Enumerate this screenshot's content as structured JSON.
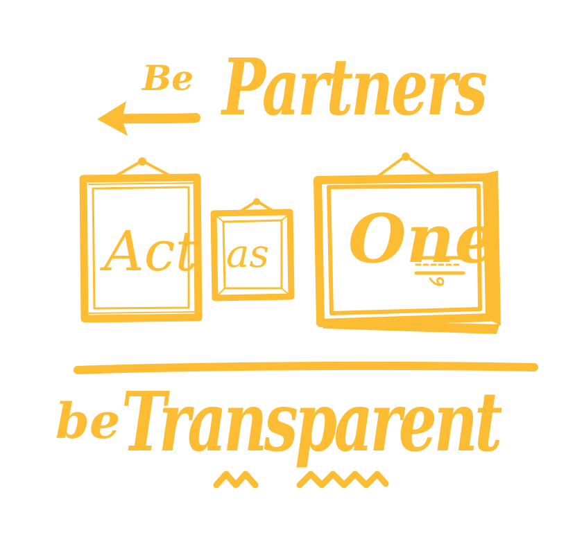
{
  "colors": {
    "ink": "#FCBC33",
    "background": "#FFFFFF"
  },
  "lettering": {
    "be_small": "Be",
    "partners": "Partners",
    "act": "Act",
    "as": "as",
    "one": "One",
    "be_lower": "be",
    "transparent": "Transparent"
  },
  "icons": [
    "arrow-left-icon",
    "picture-frame-icon",
    "zigzag-icon"
  ]
}
